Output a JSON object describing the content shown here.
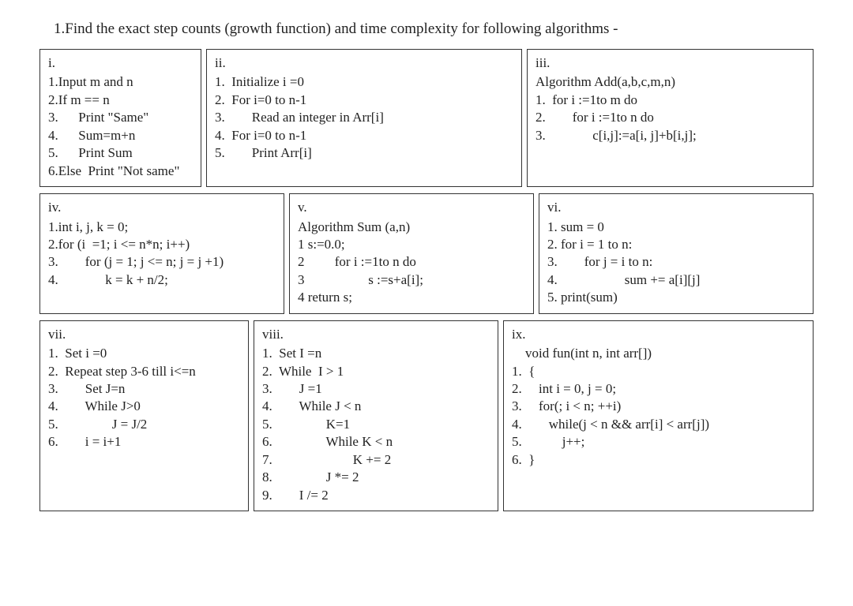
{
  "title": "1.Find the exact step counts (growth function) and time complexity for following algorithms -",
  "boxes": {
    "i": {
      "label": "i.",
      "lines": [
        "1.Input m and n",
        "2.If m == n",
        "3.      Print \"Same\"",
        "4.      Sum=m+n",
        "5.      Print Sum",
        "6.Else  Print \"Not same\""
      ]
    },
    "ii": {
      "label": "ii.",
      "lines": [
        "1.  Initialize i =0",
        "2.  For i=0 to n-1",
        "3.        Read an integer in Arr[i]",
        "4.  For i=0 to n-1",
        "5.        Print Arr[i]"
      ]
    },
    "iii": {
      "label": "iii.",
      "lines": [
        "Algorithm Add(a,b,c,m,n)",
        "1.  for i :=1to m do",
        "2.        for i :=1to n do",
        "3.              c[i,j]:=a[i, j]+b[i,j];"
      ]
    },
    "iv": {
      "label": "iv.",
      "lines": [
        "1.int i, j, k = 0;",
        "2.for (i  =1; i <= n*n; i++)",
        "3.        for (j = 1; j <= n; j = j +1)",
        "4.              k = k + n/2;"
      ]
    },
    "v": {
      "label": "v.",
      "lines": [
        "Algorithm Sum (a,n)",
        "1 s:=0.0;",
        "2         for i :=1to n do",
        "3                   s :=s+a[i];",
        "4 return s;"
      ]
    },
    "vi": {
      "label": "vi.",
      "lines": [
        "1. sum = 0",
        "2. for i = 1 to n:",
        "3.        for j = i to n:",
        "4.                    sum += a[i][j]",
        "5. print(sum)"
      ]
    },
    "vii": {
      "label": "vii.",
      "lines": [
        "1.  Set i =0",
        "2.  Repeat step 3-6 till i<=n",
        "3.        Set J=n",
        "4.        While J>0",
        "5.                J = J/2",
        "6.        i = i+1"
      ]
    },
    "viii": {
      "label": "viii.",
      "lines": [
        "1.  Set I =n",
        "2.  While  I > 1",
        "3.        J =1",
        "4.        While J < n",
        "5.                K=1",
        "6.                While K < n",
        "7.                        K += 2",
        "8.                J *= 2",
        "9.        I /= 2"
      ]
    },
    "ix": {
      "label": "ix.",
      "lines": [
        "    void fun(int n, int arr[])",
        "1.  {",
        "2.     int i = 0, j = 0;",
        "3.     for(; i < n; ++i)",
        "4.        while(j < n && arr[i] < arr[j])",
        "5.            j++;",
        "6.  }"
      ]
    }
  }
}
